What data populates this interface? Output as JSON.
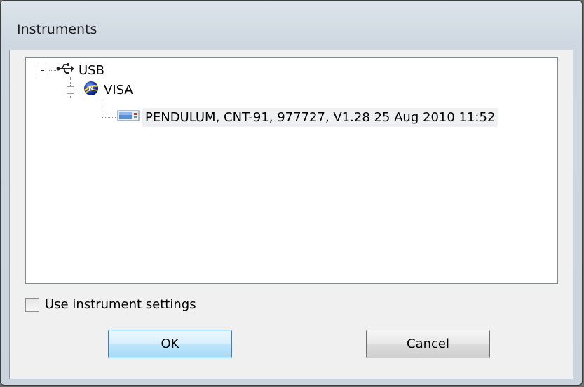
{
  "window": {
    "title": "Instruments"
  },
  "tree": {
    "nodes": [
      {
        "label": "USB",
        "icon": "usb-icon",
        "expanded": true
      },
      {
        "label": "VISA",
        "icon": "visa-icon",
        "expanded": true
      },
      {
        "label": "PENDULUM, CNT-91, 977727, V1.28 25 Aug 2010 11:52",
        "icon": "instrument-icon",
        "selected": true
      }
    ]
  },
  "options": {
    "use_instrument_settings_label": "Use instrument settings",
    "use_instrument_settings_checked": false
  },
  "buttons": {
    "ok_label": "OK",
    "cancel_label": "Cancel"
  },
  "colors": {
    "ok_button_border": "#3c7fb1",
    "selection_bg": "#eef0f2"
  }
}
